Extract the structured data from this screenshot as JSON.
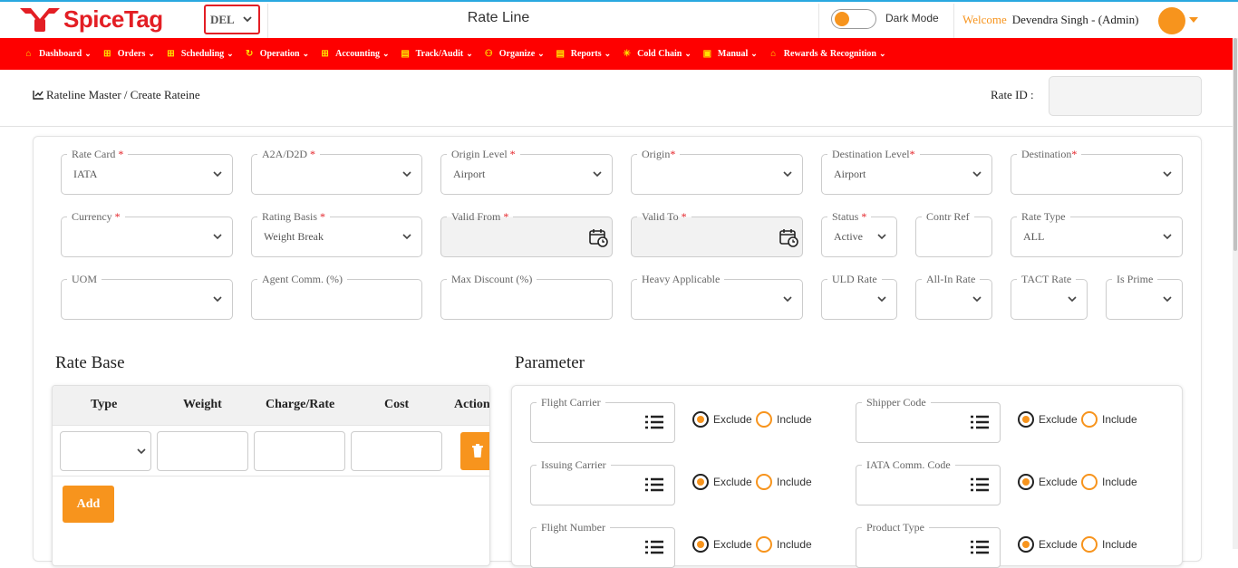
{
  "header": {
    "brand": "SpiceTag",
    "station": "DEL",
    "page_title": "Rate Line",
    "dark_mode_label": "Dark Mode",
    "welcome_label": "Welcome",
    "user_name": "Devendra Singh - (Admin)"
  },
  "nav": {
    "items": [
      {
        "label": "Dashboard",
        "icon": "home-icon"
      },
      {
        "label": "Orders",
        "icon": "plus-square-icon"
      },
      {
        "label": "Scheduling",
        "icon": "plus-square-icon"
      },
      {
        "label": "Operation",
        "icon": "refresh-icon"
      },
      {
        "label": "Accounting",
        "icon": "plus-square-icon"
      },
      {
        "label": "Track/Audit",
        "icon": "file-icon"
      },
      {
        "label": "Organize",
        "icon": "sitemap-icon"
      },
      {
        "label": "Reports",
        "icon": "file-icon"
      },
      {
        "label": "Cold Chain",
        "icon": "snowflake-icon"
      },
      {
        "label": "Manual",
        "icon": "book-icon"
      },
      {
        "label": "Rewards & Recognition",
        "icon": "home-icon"
      }
    ]
  },
  "breadcrumb": {
    "text": "Rateline Master / Create Rateine",
    "rate_id_label": "Rate ID :",
    "rate_id_value": ""
  },
  "form": {
    "rate_card": {
      "label": "Rate Card",
      "value": "IATA"
    },
    "a2a_d2d": {
      "label": "A2A/D2D",
      "value": ""
    },
    "origin_level": {
      "label": "Origin Level",
      "value": "Airport"
    },
    "origin": {
      "label": "Origin",
      "value": ""
    },
    "destination_level": {
      "label": "Destination Level",
      "value": "Airport"
    },
    "destination": {
      "label": "Destination",
      "value": ""
    },
    "currency": {
      "label": "Currency",
      "value": ""
    },
    "rating_basis": {
      "label": "Rating Basis",
      "value": "Weight Break"
    },
    "valid_from": {
      "label": "Valid From",
      "value": ""
    },
    "valid_to": {
      "label": "Valid To",
      "value": ""
    },
    "status": {
      "label": "Status",
      "value": "Active"
    },
    "contr_ref": {
      "label": "Contr Ref",
      "value": ""
    },
    "rate_type": {
      "label": "Rate Type",
      "value": "ALL"
    },
    "uom": {
      "label": "UOM",
      "value": ""
    },
    "agent_comm": {
      "label": "Agent Comm. (%)",
      "value": ""
    },
    "max_discount": {
      "label": "Max Discount (%)",
      "value": ""
    },
    "heavy_applicable": {
      "label": "Heavy Applicable",
      "value": ""
    },
    "uld_rate": {
      "label": "ULD Rate",
      "value": ""
    },
    "all_in_rate": {
      "label": "All-In Rate",
      "value": ""
    },
    "tact_rate": {
      "label": "TACT Rate",
      "value": ""
    },
    "is_prime": {
      "label": "Is Prime",
      "value": ""
    }
  },
  "rate_base": {
    "title": "Rate Base",
    "columns": [
      "Type",
      "Weight",
      "Charge/Rate",
      "Cost",
      "Action"
    ],
    "add_label": "Add"
  },
  "parameter": {
    "title": "Parameter",
    "exclude_label": "Exclude",
    "include_label": "Include",
    "fields": [
      {
        "label": "Flight Carrier",
        "selected": "Exclude"
      },
      {
        "label": "Shipper Code",
        "selected": "Exclude"
      },
      {
        "label": "Issuing Carrier",
        "selected": "Exclude"
      },
      {
        "label": "IATA Comm. Code",
        "selected": "Exclude"
      },
      {
        "label": "Flight Number",
        "selected": "Exclude"
      },
      {
        "label": "Product Type",
        "selected": "Exclude"
      }
    ]
  },
  "colors": {
    "brand_red": "#fe0000",
    "accent_orange": "#f7941d",
    "top_border": "#29a8e0"
  }
}
